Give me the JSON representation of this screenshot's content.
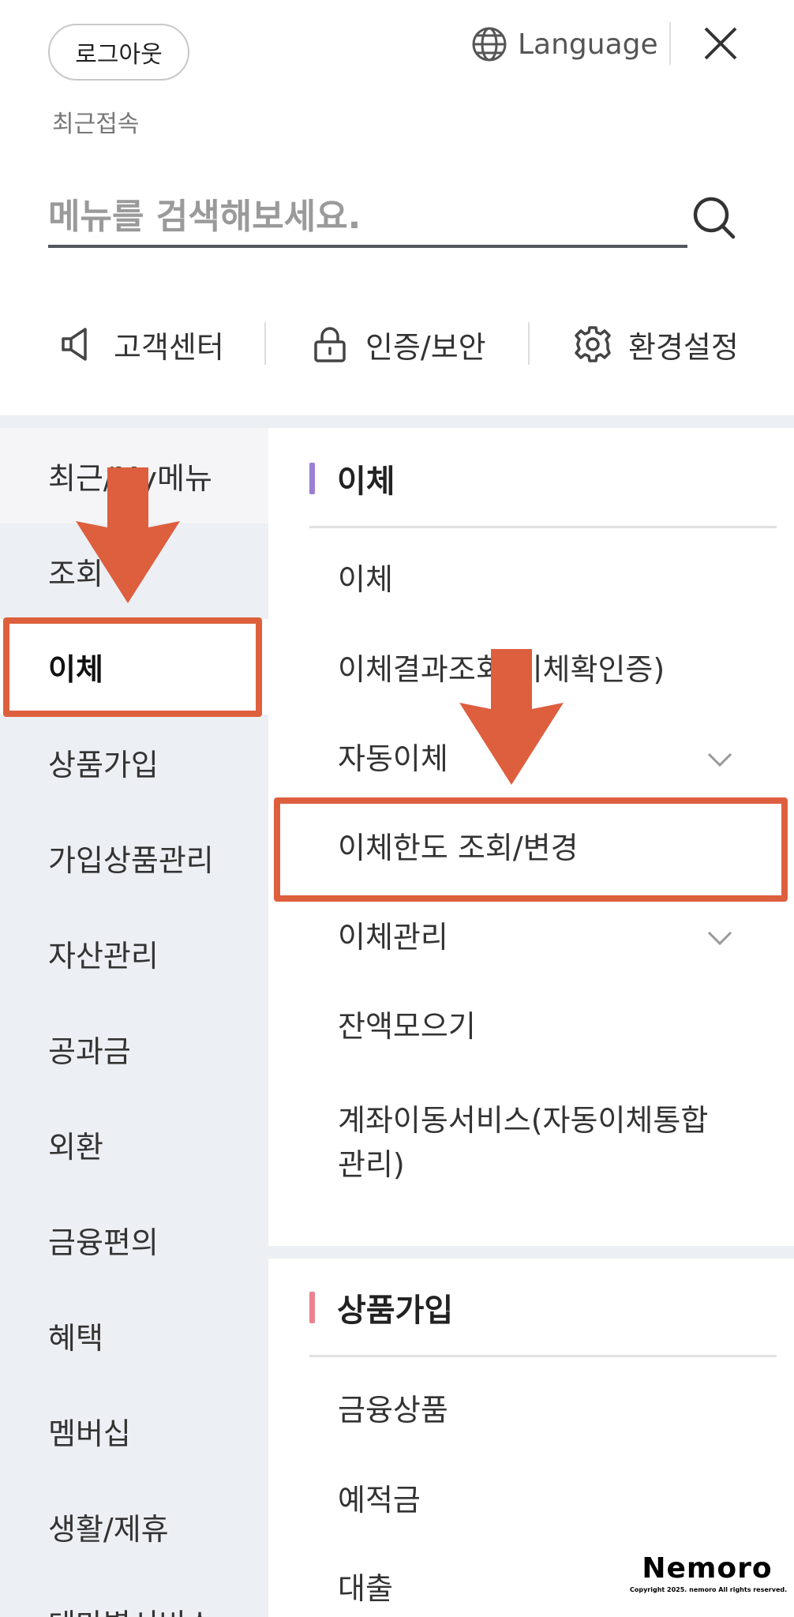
{
  "header": {
    "logout_label": "로그아웃",
    "language_label": "Language",
    "recent_access_label": "최근접속"
  },
  "search": {
    "placeholder": "메뉴를 검색해보세요."
  },
  "quick_links": [
    {
      "label": "고객센터",
      "icon": "megaphone-icon"
    },
    {
      "label": "인증/보안",
      "icon": "lock-icon"
    },
    {
      "label": "환경설정",
      "icon": "gear-icon"
    }
  ],
  "sidebar": {
    "items": [
      {
        "label": "최근/My메뉴"
      },
      {
        "label": "조회"
      },
      {
        "label": "이체",
        "active": true
      },
      {
        "label": "상품가입"
      },
      {
        "label": "가입상품관리"
      },
      {
        "label": "자산관리"
      },
      {
        "label": "공과금"
      },
      {
        "label": "외환"
      },
      {
        "label": "금융편의"
      },
      {
        "label": "혜택"
      },
      {
        "label": "멤버십"
      },
      {
        "label": "생활/제휴"
      },
      {
        "label": "테마별서비스"
      }
    ]
  },
  "sections": [
    {
      "title": "이체",
      "accent_color": "#9b7fd4",
      "items": [
        {
          "label": "이체",
          "expandable": false
        },
        {
          "label": "이체결과조회(이체확인증)",
          "expandable": false
        },
        {
          "label": "자동이체",
          "expandable": true
        },
        {
          "label": "이체한도 조회/변경",
          "expandable": false,
          "highlighted": true
        },
        {
          "label": "이체관리",
          "expandable": true
        },
        {
          "label": "잔액모으기",
          "expandable": false
        },
        {
          "label": "계좌이동서비스(자동이체통합관리)",
          "expandable": false
        }
      ]
    },
    {
      "title": "상품가입",
      "accent_color": "#e8838f",
      "items": [
        {
          "label": "금융상품"
        },
        {
          "label": "예적금"
        },
        {
          "label": "대출"
        }
      ]
    }
  ],
  "watermark": {
    "brand": "Nemoro",
    "copyright": "Copyright 2025. nemoro All rights reserved."
  },
  "colors": {
    "annotation": "#dd5f3e",
    "sidebar_bg": "#eceff3"
  }
}
